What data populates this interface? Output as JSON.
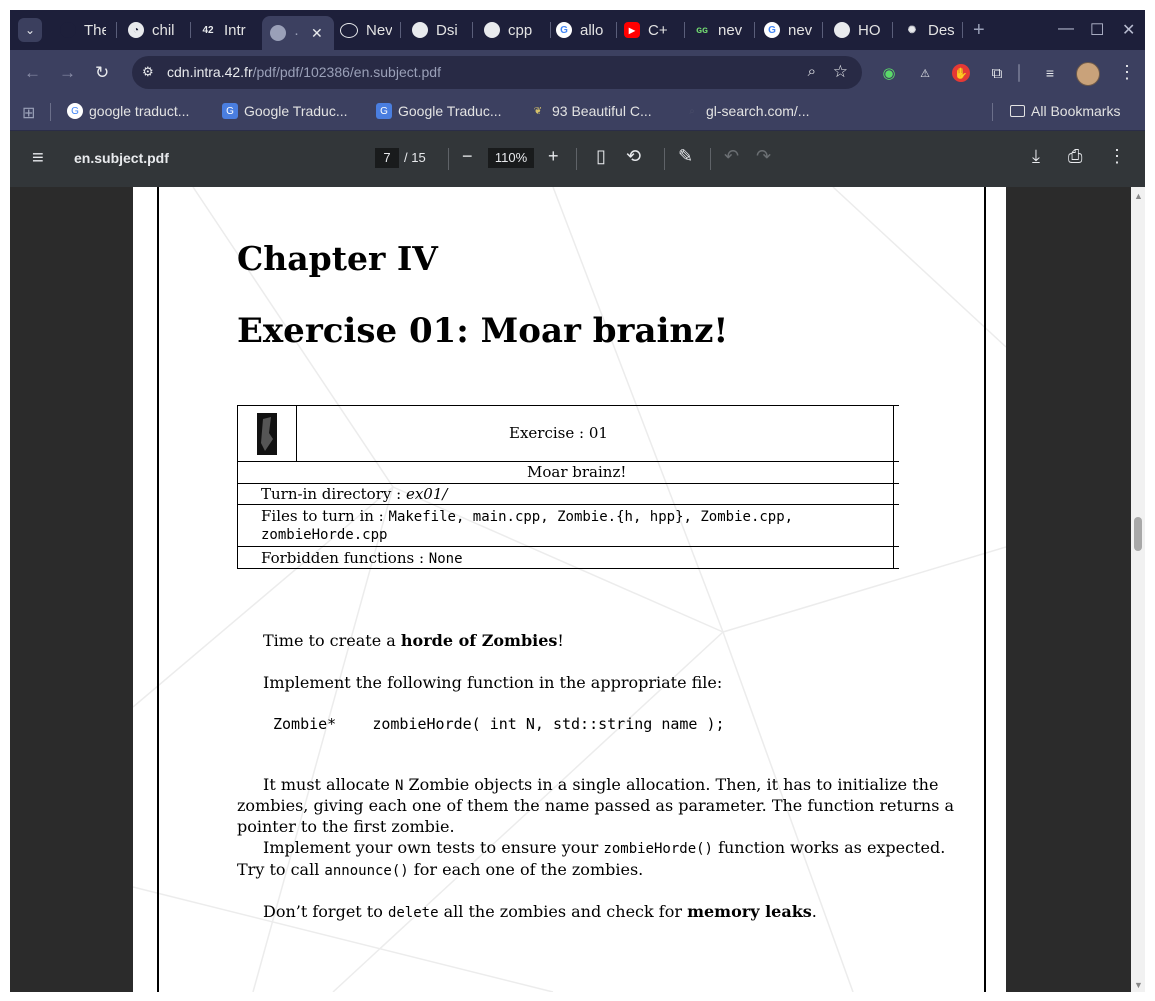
{
  "tabs": [
    {
      "title": "The"
    },
    {
      "title": "chil"
    },
    {
      "title": "Intr"
    },
    {
      "title": "·",
      "active": true
    },
    {
      "title": "Nev"
    },
    {
      "title": "Dsi"
    },
    {
      "title": "cpp"
    },
    {
      "title": "allo"
    },
    {
      "title": "C+"
    },
    {
      "title": "nev"
    },
    {
      "title": "nev"
    },
    {
      "title": "HO"
    },
    {
      "title": "Des"
    }
  ],
  "address": {
    "host": "cdn.intra.42.fr",
    "path": "/pdf/pdf/102386/en.subject.pdf"
  },
  "bookmarks": [
    {
      "label": "google traduct..."
    },
    {
      "label": "Google Traduc..."
    },
    {
      "label": "Google Traduc..."
    },
    {
      "label": "93 Beautiful C..."
    },
    {
      "label": "gl-search.com/..."
    }
  ],
  "all_bookmarks": "All Bookmarks",
  "pdf": {
    "filename": "en.subject.pdf",
    "page": "7",
    "total": "/ 15",
    "zoom": "110%"
  },
  "doc": {
    "chapter": "Chapter IV",
    "exercise_title": "Exercise 01: Moar brainz!",
    "box": {
      "exercise": "Exercise : 01",
      "subtitle": "Moar brainz!",
      "turnin_label": "Turn-in directory : ",
      "turnin_value": "ex01/",
      "files_label": "Files to turn in : ",
      "files_line1": "Makefile, main.cpp, Zombie.{h, hpp}, Zombie.cpp,",
      "files_line2": "zombieHorde.cpp",
      "forbidden_label": "Forbidden functions : ",
      "forbidden_value": "None"
    },
    "p1_a": "Time to create a ",
    "p1_b": "horde of Zombies",
    "p1_c": "!",
    "p2": "Implement the following function in the appropriate file:",
    "code": "Zombie*    zombieHorde( int N, std::string name );",
    "p3_l1a": "It must allocate ",
    "p3_l1b": "N",
    "p3_l1c": " Zombie objects in a single allocation. Then, it has to initialize the",
    "p3_l2": "zombies, giving each one of them the name passed as parameter. The function returns a",
    "p3_l3": "pointer to the first zombie.",
    "p4_l1a": "Implement your own tests to ensure your ",
    "p4_l1b": "zombieHorde()",
    "p4_l1c": " function works as expected.",
    "p4_l2a": "Try to call ",
    "p4_l2b": "announce()",
    "p4_l2c": " for each one of the zombies.",
    "p5_a": "Don’t forget to ",
    "p5_b": "delete",
    "p5_c": " all the zombies and check for ",
    "p5_d": "memory leaks",
    "p5_e": "."
  },
  "colors": {
    "tabstrip": "#1d1f3a",
    "toolbar": "#3c4060",
    "pdfbar": "#323639",
    "viewer": "#2b2b2b"
  }
}
